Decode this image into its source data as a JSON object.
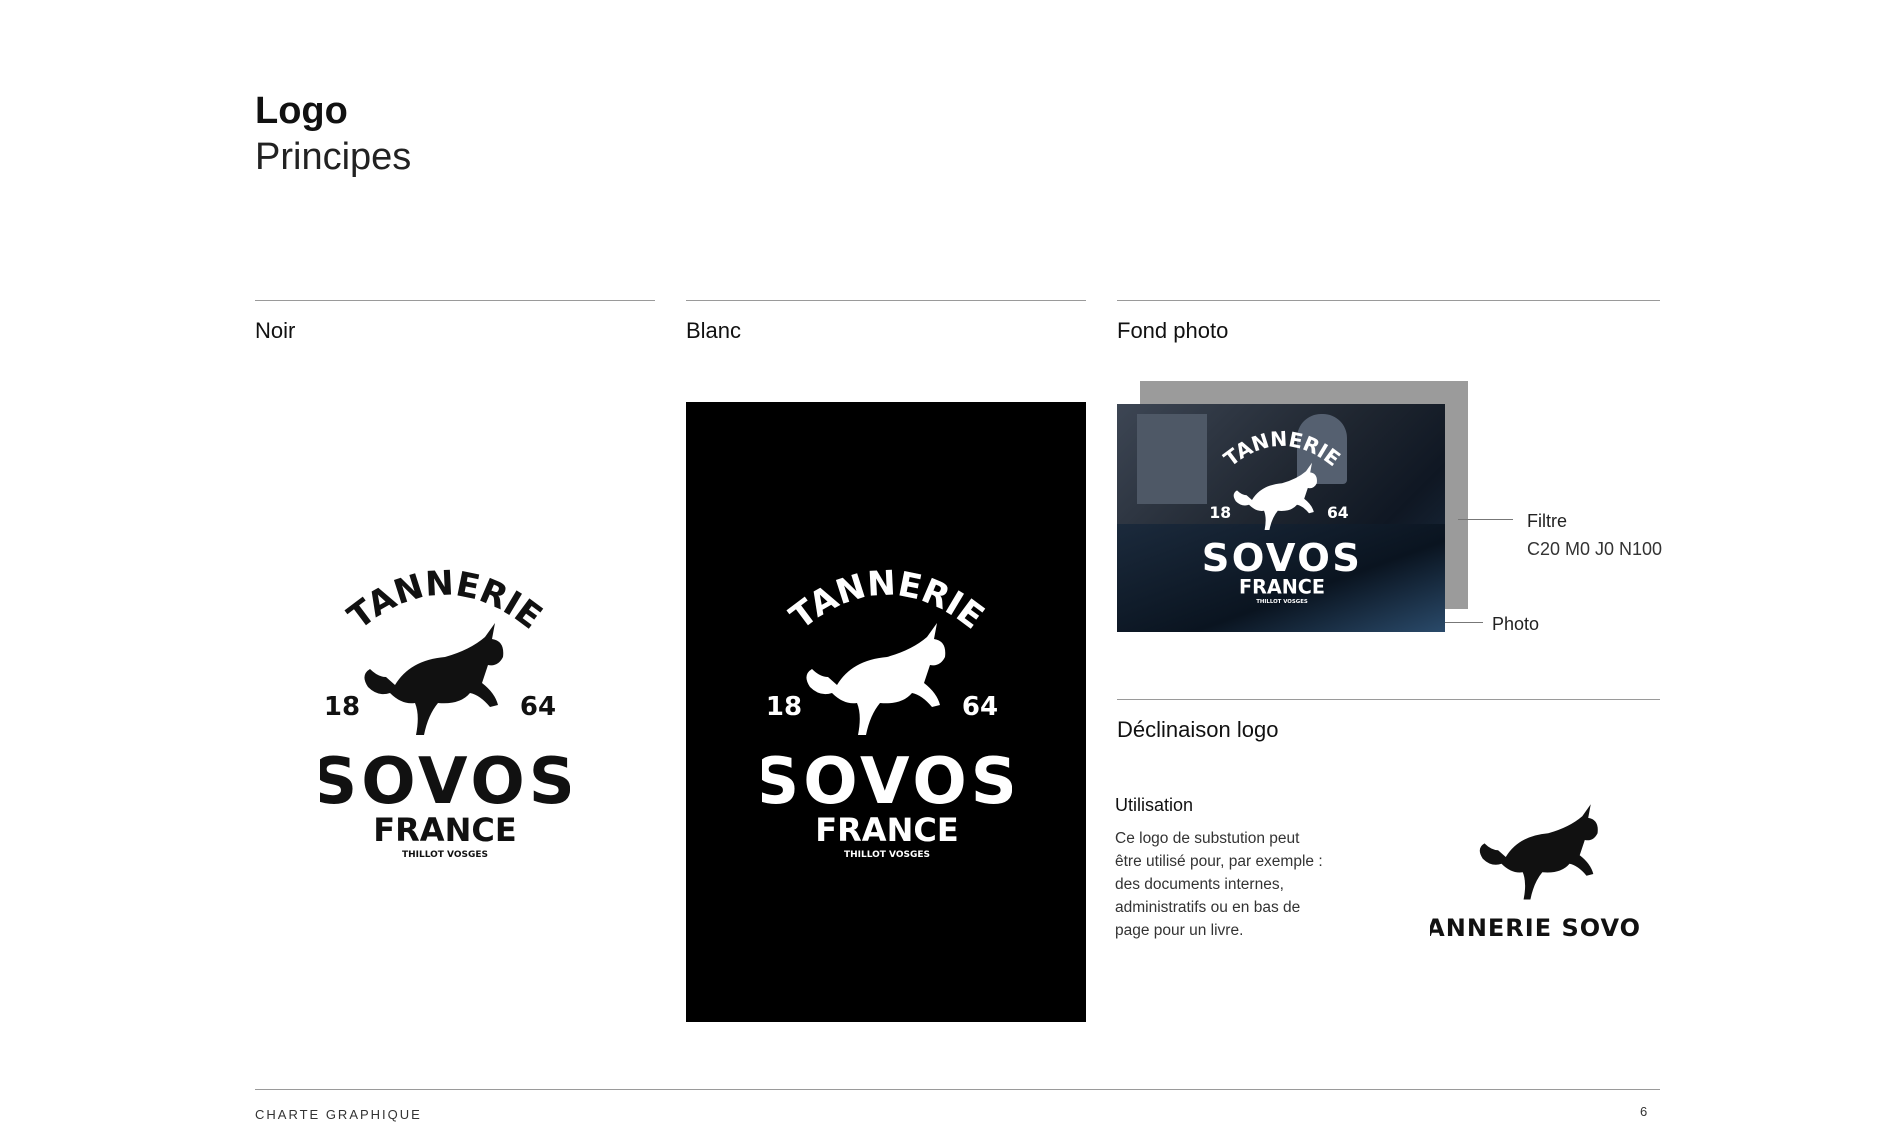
{
  "header": {
    "title": "Logo",
    "subtitle": "Principes"
  },
  "sections": {
    "noir": "Noir",
    "blanc": "Blanc",
    "fond_photo": "Fond photo",
    "declinaison": "Déclinaison logo"
  },
  "logo": {
    "top_word": "TANNERIE",
    "year_left": "18",
    "year_right": "64",
    "brand": "SOVOS",
    "country": "FRANCE",
    "location": "THILLOT VOSGES",
    "alt_wordmark": "TANNERIE SOVOS"
  },
  "photo_annotations": {
    "filter_label": "Filtre",
    "filter_value": "C20 M0 J0 N100",
    "photo_label": "Photo"
  },
  "usage": {
    "title": "Utilisation",
    "text": "Ce logo de substution peut être utilisé pour, par exemple : des documents internes, administratifs ou en bas de page pour un livre."
  },
  "footer": {
    "label": "CHARTE GRAPHIQUE",
    "page": "6"
  },
  "colors": {
    "black": "#000000",
    "white": "#ffffff",
    "filter_gray": "#9b9b9b",
    "rule_gray": "#9a9a9a"
  }
}
